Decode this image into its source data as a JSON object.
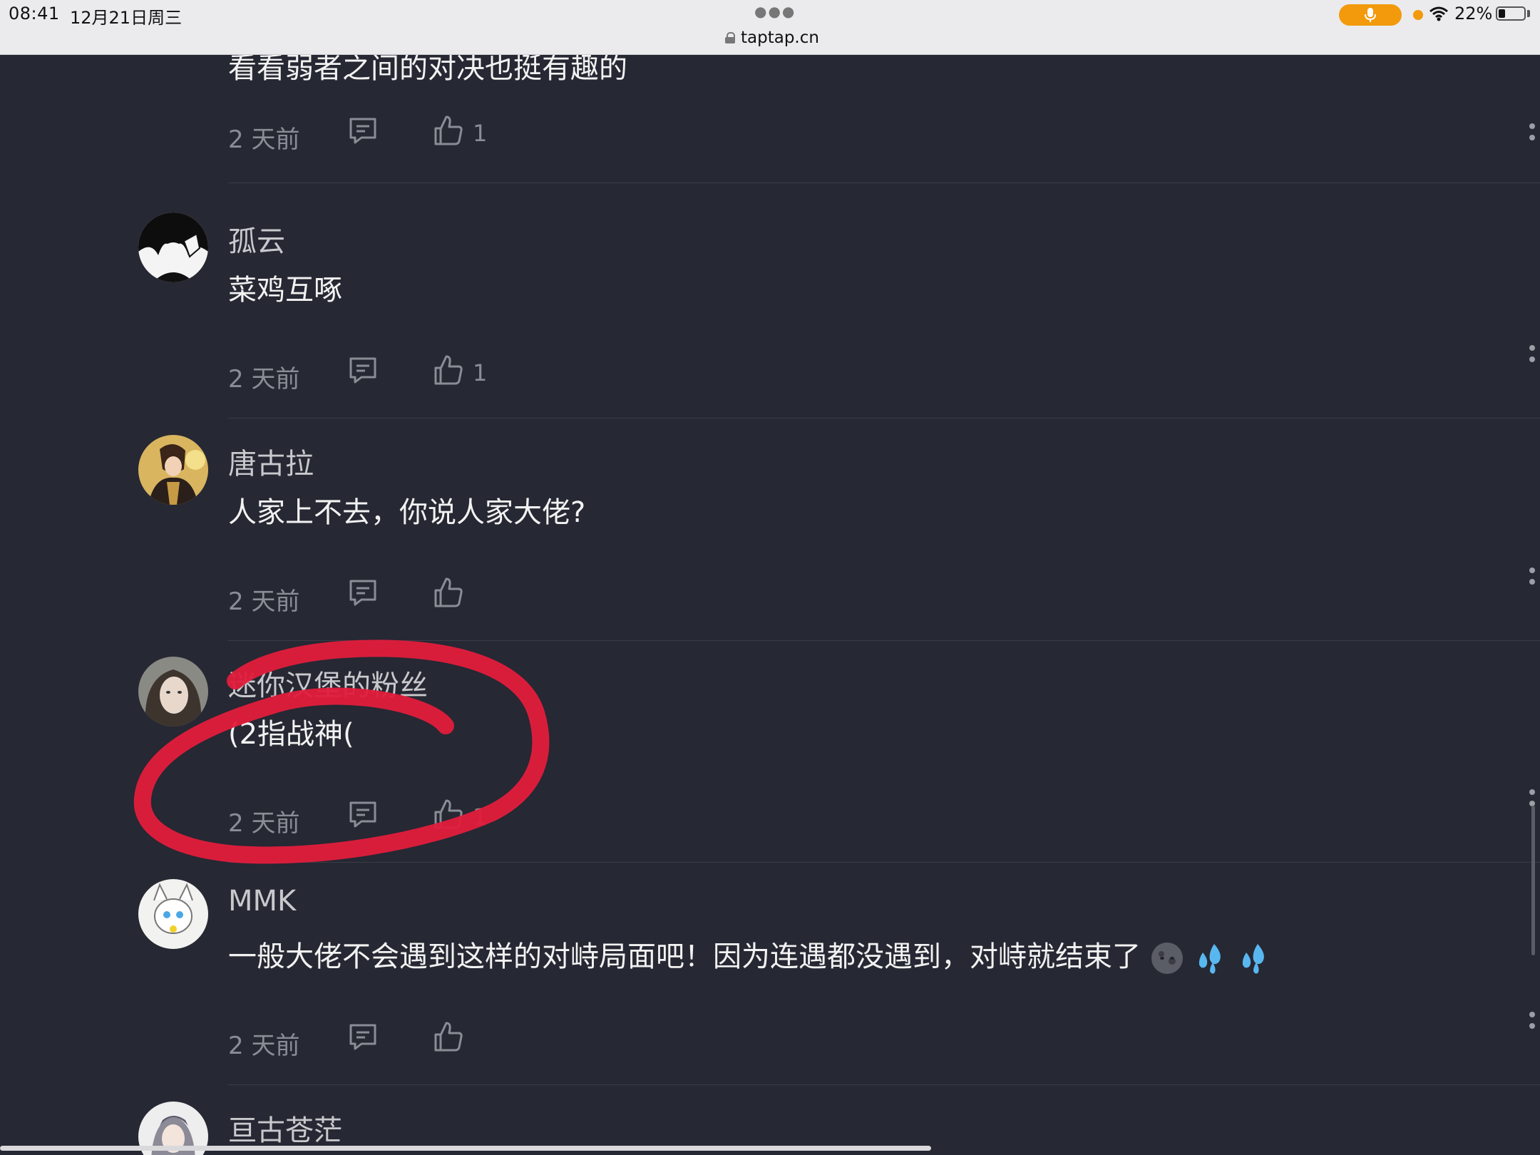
{
  "status_bar": {
    "time": "08:41",
    "date": "12月21日周三",
    "battery_percent": "22%",
    "battery_level": 0.22,
    "accent_color": "#f29a0b"
  },
  "browser": {
    "url": "taptap.cn",
    "menu_icon": "ellipsis-icon"
  },
  "top_partial": {
    "text": "看看弱者之间的对决也挺有趣的",
    "time": "2 天前",
    "likes": "1"
  },
  "comments": [
    {
      "username": "孤云",
      "text": "菜鸡互啄",
      "time": "2 天前",
      "likes": "1"
    },
    {
      "username": "唐古拉",
      "text": "人家上不去，你说人家大佬?",
      "time": "2 天前",
      "likes": ""
    },
    {
      "username": "迷你汉堡的粉丝",
      "text": "(2指战神(",
      "time": "2 天前",
      "likes": "1"
    },
    {
      "username": "MMK",
      "text": "一般大佬不会遇到这样的对峙局面吧！因为连遇都没遇到，对峙就结束了",
      "time": "2 天前",
      "likes": ""
    },
    {
      "username": "亘古苍茫",
      "text": "",
      "time": "",
      "likes": ""
    }
  ],
  "icons": {
    "reply": "comment-icon",
    "like": "thumbs-up-icon",
    "more": "more-vertical-icon",
    "emoji": [
      "new-moon-face-icon",
      "sweat-droplets-icon",
      "sweat-droplets-icon"
    ]
  },
  "annotation": {
    "type": "red-circle-markup",
    "color": "#e21c3c"
  }
}
